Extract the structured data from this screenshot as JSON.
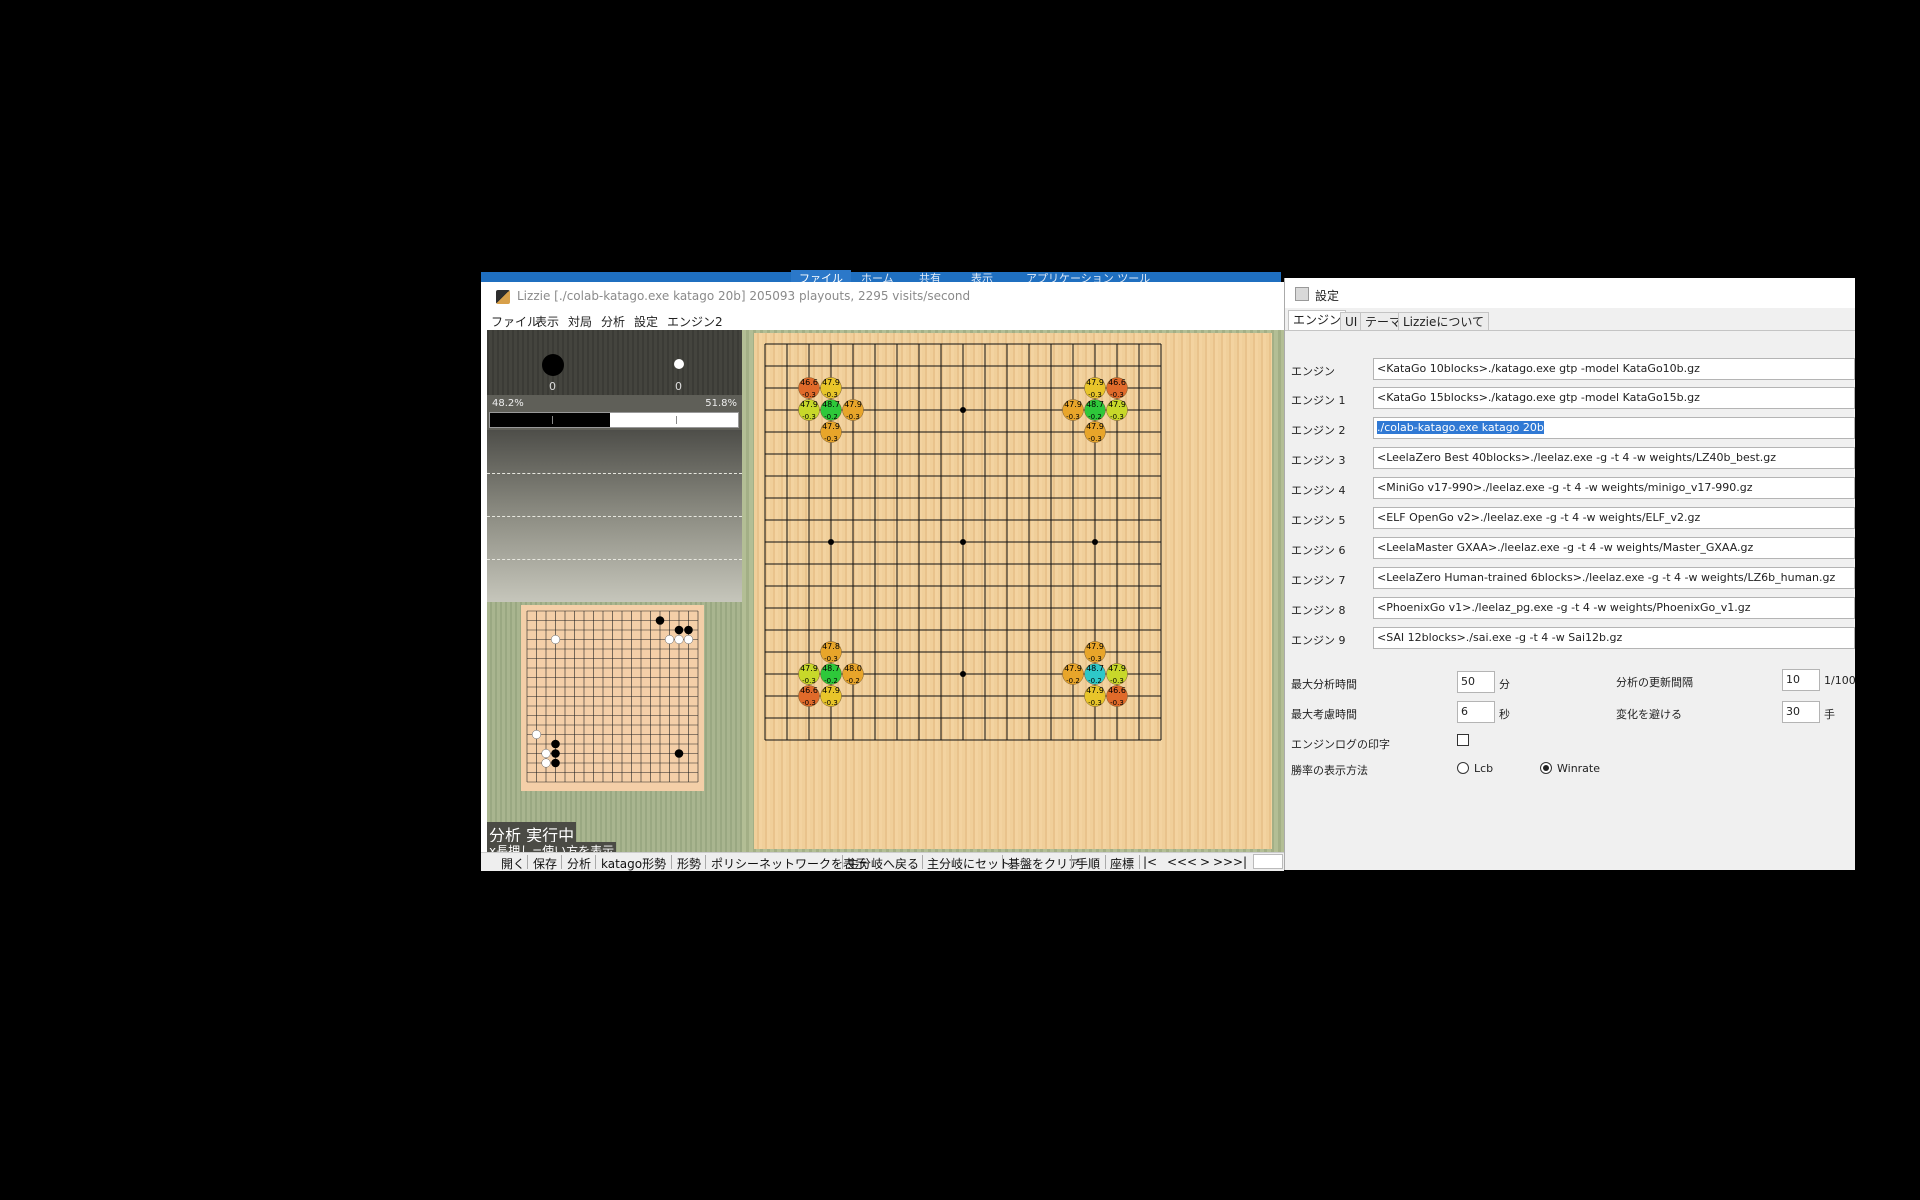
{
  "background": {
    "ribbon_tabs": [
      "ファイル",
      "ホーム",
      "共有",
      "表示",
      "アプリケーション ツール"
    ]
  },
  "lizzie": {
    "title": "Lizzie [./colab-katago.exe katago 20b] 205093 playouts, 2295 visits/second",
    "menu": [
      "ファイル",
      "表示",
      "対局",
      "分析",
      "設定",
      "エンジン2"
    ],
    "captures": {
      "black": "0",
      "white": "0"
    },
    "winrate": {
      "black_label": "48.2%",
      "white_label": "51.8%",
      "black_fraction": 0.482
    },
    "status_line1": "分析 実行中",
    "status_line2": "x長押し=使い方を表示",
    "toolbar": [
      "開く",
      "保存",
      "分析",
      "katago形勢",
      "形勢",
      "ポリシーネットワークを表示",
      "主分岐へ戻る",
      "主分岐にセット",
      "碁盤をクリア",
      "手順",
      "座標",
      "|<",
      "<<",
      "<",
      ">",
      ">>",
      ">|"
    ],
    "board": {
      "size": 19,
      "hoshi": [
        [
          3,
          3
        ],
        [
          3,
          9
        ],
        [
          3,
          15
        ],
        [
          9,
          3
        ],
        [
          9,
          9
        ],
        [
          9,
          15
        ],
        [
          15,
          3
        ],
        [
          15,
          9
        ],
        [
          15,
          15
        ]
      ],
      "candidates": [
        {
          "col": 2,
          "row": 2,
          "t": "46.6",
          "m": "",
          "b": "-0.3",
          "color": "#e06a2a"
        },
        {
          "col": 3,
          "row": 2,
          "t": "47.9",
          "m": "",
          "b": "-0.3",
          "color": "#e8c52a"
        },
        {
          "col": 2,
          "row": 3,
          "t": "47.9",
          "m": "",
          "b": "-0.3",
          "color": "#c8d82a"
        },
        {
          "col": 3,
          "row": 3,
          "t": "48.7",
          "m": "",
          "b": "-0.2",
          "color": "#2ec83a"
        },
        {
          "col": 4,
          "row": 3,
          "t": "47.9",
          "m": "",
          "b": "-0.3",
          "color": "#e8a52a"
        },
        {
          "col": 3,
          "row": 4,
          "t": "47.9",
          "m": "",
          "b": "-0.3",
          "color": "#e8a52a"
        },
        {
          "col": 15,
          "row": 2,
          "t": "47.9",
          "m": "",
          "b": "-0.3",
          "color": "#e8c52a"
        },
        {
          "col": 16,
          "row": 2,
          "t": "46.6",
          "m": "",
          "b": "-0.3",
          "color": "#e06a2a"
        },
        {
          "col": 14,
          "row": 3,
          "t": "47.9",
          "m": "",
          "b": "-0.3",
          "color": "#e8a52a"
        },
        {
          "col": 15,
          "row": 3,
          "t": "48.7",
          "m": "",
          "b": "-0.2",
          "color": "#2ec83a"
        },
        {
          "col": 16,
          "row": 3,
          "t": "47.9",
          "m": "",
          "b": "-0.3",
          "color": "#c8d82a"
        },
        {
          "col": 15,
          "row": 4,
          "t": "47.9",
          "m": "",
          "b": "-0.3",
          "color": "#e8a52a"
        },
        {
          "col": 3,
          "row": 14,
          "t": "47.8",
          "m": "",
          "b": "-0.3",
          "color": "#e8a52a"
        },
        {
          "col": 2,
          "row": 15,
          "t": "47.9",
          "m": "",
          "b": "-0.3",
          "color": "#c8d82a"
        },
        {
          "col": 3,
          "row": 15,
          "t": "48.7",
          "m": "",
          "b": "-0.2",
          "color": "#2ec83a"
        },
        {
          "col": 4,
          "row": 15,
          "t": "48.0",
          "m": "",
          "b": "-0.2",
          "color": "#e8a52a"
        },
        {
          "col": 2,
          "row": 16,
          "t": "46.6",
          "m": "",
          "b": "-0.3",
          "color": "#e06a2a"
        },
        {
          "col": 3,
          "row": 16,
          "t": "47.9",
          "m": "",
          "b": "-0.3",
          "color": "#e8c52a"
        },
        {
          "col": 15,
          "row": 14,
          "t": "47.9",
          "m": "",
          "b": "-0.3",
          "color": "#e8a52a"
        },
        {
          "col": 14,
          "row": 15,
          "t": "47.9",
          "m": "",
          "b": "-0.2",
          "color": "#e8a52a"
        },
        {
          "col": 15,
          "row": 15,
          "t": "48.7",
          "m": "",
          "b": "-0.2",
          "color": "#2ec8c8"
        },
        {
          "col": 16,
          "row": 15,
          "t": "47.9",
          "m": "",
          "b": "-0.3",
          "color": "#c8d82a"
        },
        {
          "col": 15,
          "row": 16,
          "t": "47.9",
          "m": "",
          "b": "-0.3",
          "color": "#e8c52a"
        },
        {
          "col": 16,
          "row": 16,
          "t": "46.6",
          "m": "",
          "b": "-0.3",
          "color": "#e06a2a"
        }
      ]
    },
    "miniboard": {
      "size": 19,
      "black": [
        [
          14,
          1
        ],
        [
          16,
          2
        ],
        [
          17,
          2
        ],
        [
          3,
          14
        ],
        [
          3,
          15
        ],
        [
          3,
          16
        ],
        [
          16,
          15
        ]
      ],
      "white": [
        [
          3,
          3
        ],
        [
          15,
          3
        ],
        [
          16,
          3
        ],
        [
          17,
          3
        ],
        [
          1,
          13
        ],
        [
          2,
          15
        ],
        [
          2,
          16
        ]
      ]
    }
  },
  "settings": {
    "title": "設定",
    "tabs": [
      "エンジン",
      "UI",
      "テーマ",
      "Lizzieについて"
    ],
    "engines": [
      {
        "label": "エンジン",
        "value": "<KataGo 10blocks>./katago.exe gtp -model KataGo10b.gz"
      },
      {
        "label": "エンジン 1",
        "value": "<KataGo 15blocks>./katago.exe gtp -model KataGo15b.gz"
      },
      {
        "label": "エンジン 2",
        "value": "./colab-katago.exe katago 20b"
      },
      {
        "label": "エンジン 3",
        "value": "<LeelaZero Best 40blocks>./leelaz.exe -g -t 4 -w weights/LZ40b_best.gz"
      },
      {
        "label": "エンジン 4",
        "value": "<MiniGo v17-990>./leelaz.exe -g -t 4 -w weights/minigo_v17-990.gz"
      },
      {
        "label": "エンジン 5",
        "value": "<ELF OpenGo v2>./leelaz.exe -g -t 4 -w weights/ELF_v2.gz"
      },
      {
        "label": "エンジン 6",
        "value": "<LeelaMaster GXAA>./leelaz.exe -g -t 4 -w weights/Master_GXAA.gz"
      },
      {
        "label": "エンジン 7",
        "value": "<LeelaZero Human-trained 6blocks>./leelaz.exe -g -t 4 -w weights/LZ6b_human.gz"
      },
      {
        "label": "エンジン 8",
        "value": "<PhoenixGo v1>./leelaz_pg.exe -g -t 4 -w weights/PhoenixGo_v1.gz"
      },
      {
        "label": "エンジン 9",
        "value": "<SAI 12blocks>./sai.exe -g -t 4 -w Sai12b.gz"
      }
    ],
    "options": {
      "max_analysis_label": "最大分析時間",
      "max_analysis_value": "50",
      "max_analysis_unit": "分",
      "max_think_label": "最大考慮時間",
      "max_think_value": "6",
      "max_think_unit": "秒",
      "update_interval_label": "分析の更新間隔",
      "update_interval_value": "10",
      "update_interval_unit": "1/100",
      "avoid_label": "変化を避ける",
      "avoid_value": "30",
      "avoid_unit": "手",
      "log_label": "エンジンログの印字",
      "display_label": "勝率の表示方法",
      "radio_lcb": "Lcb",
      "radio_winrate": "Winrate"
    }
  }
}
